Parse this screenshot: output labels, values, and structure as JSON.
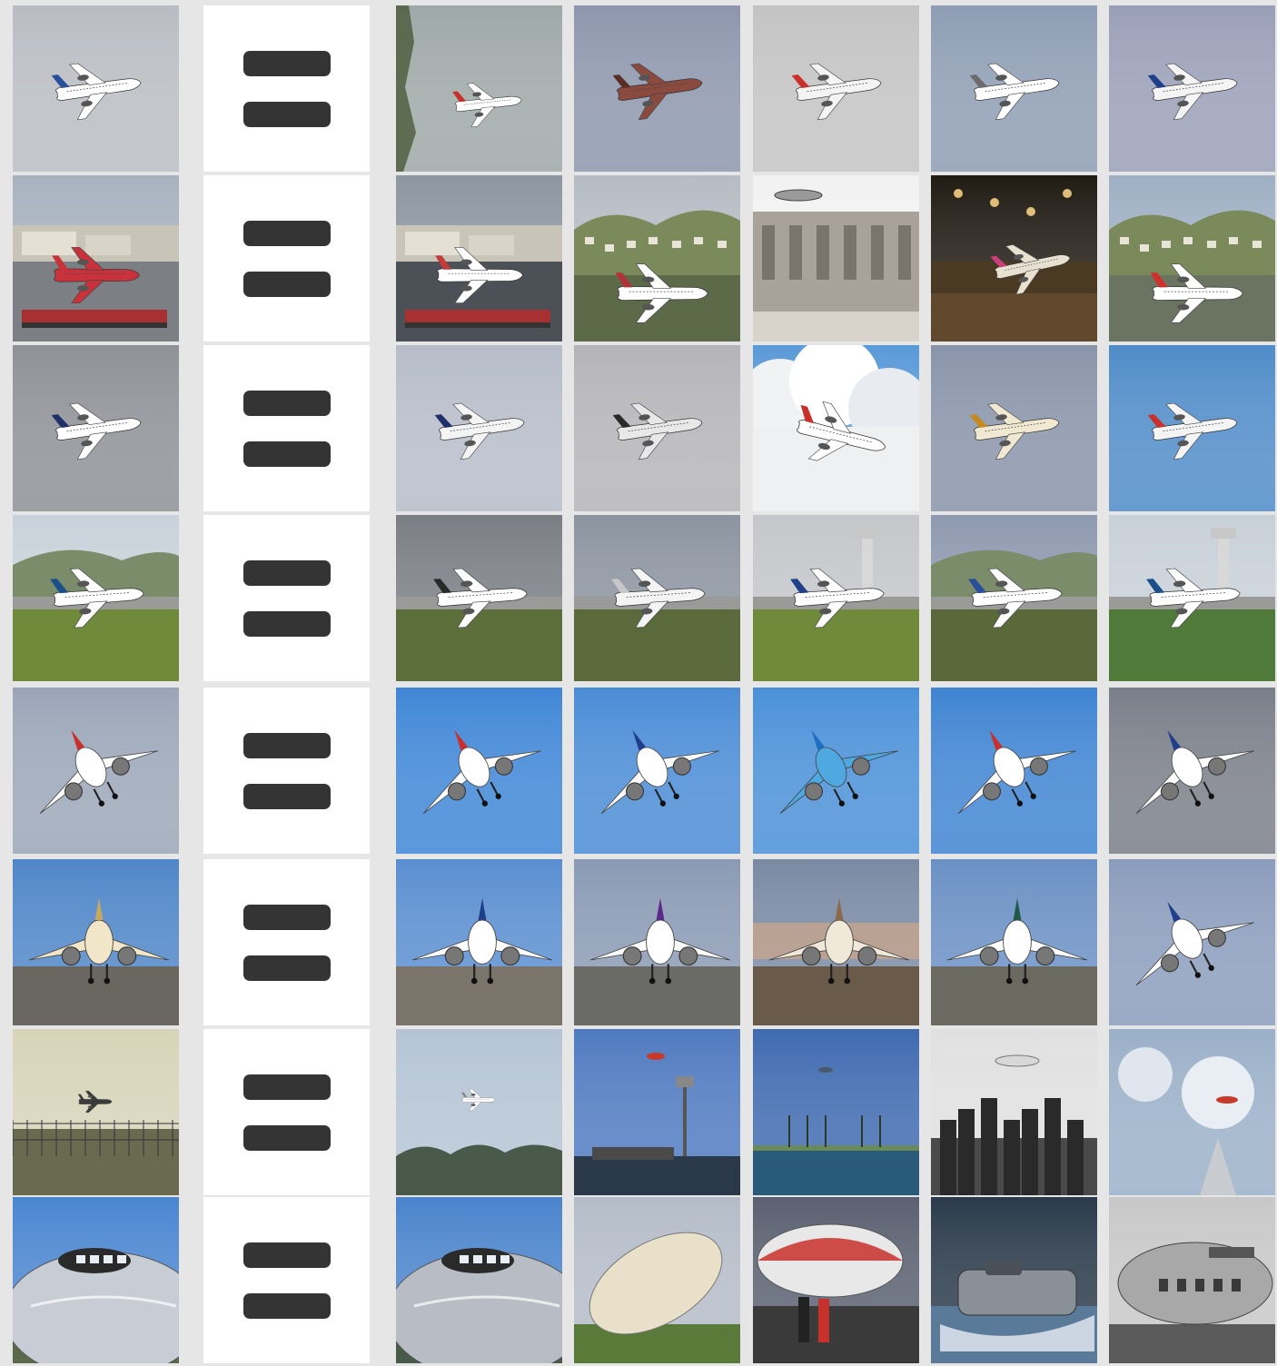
{
  "grid": {
    "columns": [
      "query",
      "equals",
      "result_1",
      "result_2",
      "result_3",
      "result_4",
      "result_5"
    ],
    "equals_icon": "equals-icon",
    "rows": [
      {
        "name": "row-1-airliners-in-sky",
        "thumbs": [
          {
            "scene": "sky",
            "sky": "#b9bcc2",
            "plane": "#ffffff",
            "tail": "#2a4f9a"
          },
          {
            "scene": "sky-tree",
            "sky": "#9ea8a6",
            "plane": "#ffffff",
            "tail": "#c9302c"
          },
          {
            "scene": "sky",
            "sky": "#8d96ad",
            "plane": "#8a4a3e",
            "tail": "#5a2e24"
          },
          {
            "scene": "sky",
            "sky": "#c3c3c3",
            "plane": "#f4f4f4",
            "tail": "#c9302c"
          },
          {
            "scene": "sky",
            "sky": "#8e9db4",
            "plane": "#ffffff",
            "tail": "#6b6b6b"
          },
          {
            "scene": "sky",
            "sky": "#9a9fb8",
            "plane": "#f4f4f4",
            "tail": "#1f3f8a"
          }
        ]
      },
      {
        "name": "row-2-airport-scenes",
        "thumbs": [
          {
            "scene": "airport",
            "sky": "#a7b2c0",
            "ground": "#7c7f84",
            "plane": "#c8323a",
            "tail": "#c8323a"
          },
          {
            "scene": "airport",
            "sky": "#8d96a0",
            "ground": "#4c5158",
            "plane": "#ffffff",
            "tail": "#c33a3a"
          },
          {
            "scene": "airport-hill",
            "sky": "#b6bcc4",
            "ground": "#5d6a4a",
            "plane": "#ffffff",
            "tail": "#b0333a"
          },
          {
            "scene": "vintage",
            "sky": "#f2f2f2",
            "ground": "#8c8680",
            "plane": "#cfcfcf",
            "tail": "#8a8a8a"
          },
          {
            "scene": "night",
            "sky": "#1f1a12",
            "ground": "#3c3020",
            "plane": "#e8e0d0",
            "tail": "#c8407a"
          },
          {
            "scene": "airport-hill",
            "sky": "#9fb0c4",
            "ground": "#6a7460",
            "plane": "#ffffff",
            "tail": "#d0302c"
          }
        ]
      },
      {
        "name": "row-3-planes-banking",
        "thumbs": [
          {
            "scene": "sky",
            "sky": "#8e9096",
            "plane": "#ffffff",
            "tail": "#1f2f6a"
          },
          {
            "scene": "sky",
            "sky": "#b6bcc8",
            "plane": "#f4f4f4",
            "tail": "#1f2f6a"
          },
          {
            "scene": "sky",
            "sky": "#b4b4b8",
            "plane": "#e8e8e8",
            "tail": "#2a2a2a"
          },
          {
            "scene": "clouds",
            "sky": "#5b9ad8",
            "plane": "#ffffff",
            "tail": "#c9302c"
          },
          {
            "scene": "sky",
            "sky": "#8994aa",
            "plane": "#f0e8d0",
            "tail": "#c48a20"
          },
          {
            "scene": "sky",
            "sky": "#4f8cc8",
            "plane": "#f4f4f4",
            "tail": "#c9302c"
          }
        ]
      },
      {
        "name": "row-4-planes-on-runway",
        "thumbs": [
          {
            "scene": "runway-hill",
            "sky": "#c9d2da",
            "ground": "#6e8a3a",
            "plane": "#ffffff",
            "tail": "#1a4f8a"
          },
          {
            "scene": "runway",
            "sky": "#7a7e84",
            "ground": "#5c6e3a",
            "plane": "#ffffff",
            "tail": "#2a2a2a"
          },
          {
            "scene": "runway",
            "sky": "#8c94a0",
            "ground": "#5a6a3a",
            "plane": "#f4f4f4",
            "tail": "#c8c8c8"
          },
          {
            "scene": "runway-tower",
            "sky": "#c4c6ca",
            "ground": "#6e8a3a",
            "plane": "#ffffff",
            "tail": "#1f3f8a"
          },
          {
            "scene": "runway-hill",
            "sky": "#8e9ab0",
            "ground": "#59693a",
            "plane": "#ffffff",
            "tail": "#2a4f9a"
          },
          {
            "scene": "runway-tower",
            "sky": "#c8d0d8",
            "ground": "#4f7a3a",
            "plane": "#ffffff",
            "tail": "#1a4f8a"
          }
        ]
      },
      {
        "name": "row-5-planes-climbing",
        "thumbs": [
          {
            "scene": "climb",
            "sky": "#9aa6b8",
            "plane": "#ffffff",
            "tail": "#c9302c"
          },
          {
            "scene": "climb",
            "sky": "#3f86d6",
            "plane": "#ffffff",
            "tail": "#c9302c"
          },
          {
            "scene": "climb",
            "sky": "#4a8cd6",
            "plane": "#ffffff",
            "tail": "#1f3f8a"
          },
          {
            "scene": "climb",
            "sky": "#4a90d8",
            "plane": "#4fa8e0",
            "tail": "#1f6fc0"
          },
          {
            "scene": "climb",
            "sky": "#3f84d2",
            "plane": "#ffffff",
            "tail": "#c9302c"
          },
          {
            "scene": "climb",
            "sky": "#7a7e88",
            "plane": "#ffffff",
            "tail": "#1f3f8a"
          }
        ]
      },
      {
        "name": "row-6-planes-parked",
        "thumbs": [
          {
            "scene": "parked",
            "sky": "#4f86c8",
            "ground": "#6a6660",
            "plane": "#f1e6c8",
            "tail": "#c8a860"
          },
          {
            "scene": "parked",
            "sky": "#5a8ed0",
            "ground": "#7a746a",
            "plane": "#ffffff",
            "tail": "#1f3f8a"
          },
          {
            "scene": "parked",
            "sky": "#8a9ab4",
            "ground": "#6a6a66",
            "plane": "#ffffff",
            "tail": "#5a2a8a"
          },
          {
            "scene": "sunset",
            "sky": "#7a8aa4",
            "ground": "#6a5a4a",
            "plane": "#f0e8d8",
            "tail": "#8a6a4a"
          },
          {
            "scene": "parked",
            "sky": "#6a90c4",
            "ground": "#6a6a60",
            "plane": "#ffffff",
            "tail": "#1f5a4a"
          },
          {
            "scene": "climb",
            "sky": "#8a9cbc",
            "plane": "#ffffff",
            "tail": "#1f3f8a"
          }
        ]
      },
      {
        "name": "row-7-distant-aircraft",
        "thumbs": [
          {
            "scene": "distant-fence",
            "sky": "#d6d4b8",
            "ground": "#6a6a50",
            "plane": "#3a3a3a",
            "tail": "#3a3a3a"
          },
          {
            "scene": "distant-trees",
            "sky": "#b4c4d4",
            "ground": "#4a5a4a",
            "plane": "#ffffff",
            "tail": "#8a8a8a"
          },
          {
            "scene": "stadium",
            "sky": "#4f7ac0",
            "ground": "#2a3a4a",
            "plane": "#c83a2a",
            "tail": "#c83a2a"
          },
          {
            "scene": "palms",
            "sky": "#3f6ab0",
            "ground": "#2a5a7a",
            "plane": "#4a5a6a",
            "tail": "#4a5a6a"
          },
          {
            "scene": "bw-city",
            "sky": "#e0e0e0",
            "ground": "#3a3a3a",
            "plane": "#d8d8d8",
            "tail": "#a8a8a8"
          },
          {
            "scene": "clouds-blimp",
            "sky": "#9ab0c8",
            "ground": "#c8ccd0",
            "plane": "#c83a2a",
            "tail": "#c83a2a"
          }
        ]
      },
      {
        "name": "row-8-closeups",
        "thumbs": [
          {
            "scene": "chrome",
            "sky": "#4a86d0",
            "ground": "#5a6a4a",
            "plane": "#c8ccd4",
            "tail": "#2a2a2a"
          },
          {
            "scene": "chrome",
            "sky": "#4a84cc",
            "ground": "#4a5a4a",
            "plane": "#b8bcc4",
            "tail": "#2a2a2a"
          },
          {
            "scene": "blimp",
            "sky": "#b4bcc8",
            "ground": "#5a7a3a",
            "plane": "#e8e0c8",
            "tail": "#c8a040"
          },
          {
            "scene": "museum",
            "sky": "#5a6070",
            "ground": "#3a3a3a",
            "plane": "#e8e8e8",
            "tail": "#c8302c"
          },
          {
            "scene": "hovercraft",
            "sky": "#2a3a4a",
            "ground": "#5a7a9a",
            "plane": "#8a9098",
            "tail": "#3a3a3a"
          },
          {
            "scene": "bw-hangar",
            "sky": "#c8c8c8",
            "ground": "#5a5a5a",
            "plane": "#a8a8a8",
            "tail": "#6a6a6a"
          }
        ]
      }
    ]
  }
}
